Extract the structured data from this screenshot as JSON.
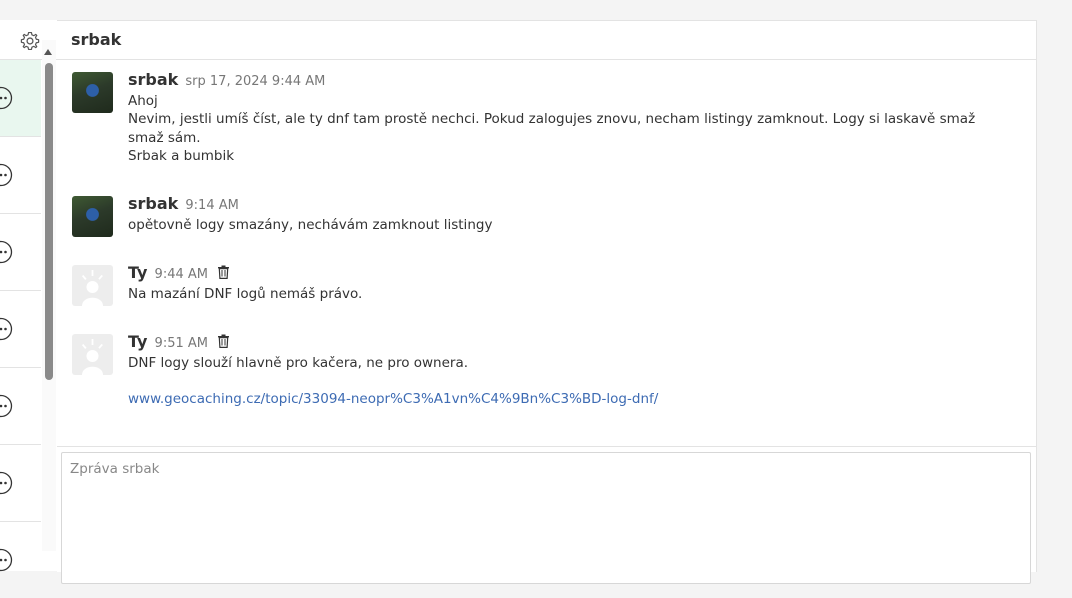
{
  "conversation": {
    "title": "srbak",
    "settings_icon": "gear-icon"
  },
  "conversation_list": {
    "items": [
      {
        "icon": "more-options-icon",
        "active": true
      },
      {
        "icon": "more-options-icon",
        "active": false
      },
      {
        "icon": "more-options-icon",
        "active": false
      },
      {
        "icon": "more-options-icon",
        "active": false
      },
      {
        "icon": "more-options-icon",
        "active": false
      },
      {
        "icon": "more-options-icon",
        "active": false
      },
      {
        "icon": "more-options-icon",
        "active": false
      }
    ]
  },
  "messages": [
    {
      "author": "srbak",
      "time": "srp 17, 2024 9:44 AM",
      "lines": [
        "Ahoj",
        "Nevim, jestli umíš číst, ale ty dnf tam prostě nechci. Pokud zalogujes znovu, necham listingy zamknout. Logy si laskavě smaž",
        "smaž sám.",
        "Srbak a bumbik"
      ]
    },
    {
      "author": "srbak",
      "time": "9:14 AM",
      "lines": [
        "opětovně logy smazány, nechávám zamknout listingy"
      ]
    },
    {
      "author": "Ty",
      "time": "9:44 AM",
      "lines": [
        "Na mazání DNF logů nemáš právo."
      ],
      "deletable": true
    },
    {
      "author": "Ty",
      "time": "9:51 AM",
      "lines": [
        "DNF logy slouží hlavně pro kačera, ne pro ownera."
      ],
      "link": "www.geocaching.cz/topic/33094-neopr%C3%A1vn%C4%9Bn%C3%BD-log-dnf/",
      "deletable": true
    }
  ],
  "composer": {
    "placeholder": "Zpráva srbak"
  },
  "colors": {
    "accent_link": "#3d6bb3",
    "active_conversation_bg": "#e9f7ef"
  }
}
